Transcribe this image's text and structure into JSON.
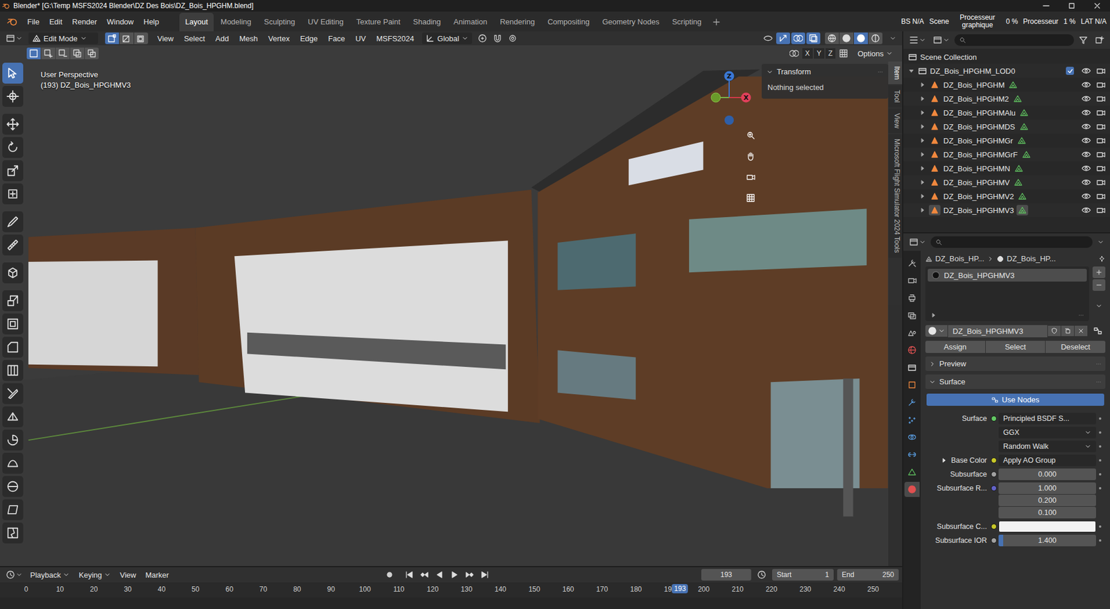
{
  "window": {
    "title": "Blender* [G:\\Temp MSFS2024 Blender\\DZ Des Bois\\DZ_Bois_HPGHM.blend]"
  },
  "menu": [
    "File",
    "Edit",
    "Render",
    "Window",
    "Help"
  ],
  "workspaces": [
    {
      "label": "Layout",
      "selected": true
    },
    {
      "label": "Modeling",
      "selected": false
    },
    {
      "label": "Sculpting",
      "selected": false
    },
    {
      "label": "UV Editing",
      "selected": false
    },
    {
      "label": "Texture Paint",
      "selected": false
    },
    {
      "label": "Shading",
      "selected": false
    },
    {
      "label": "Animation",
      "selected": false
    },
    {
      "label": "Rendering",
      "selected": false
    },
    {
      "label": "Compositing",
      "selected": false
    },
    {
      "label": "Geometry Nodes",
      "selected": false
    },
    {
      "label": "Scripting",
      "selected": false
    }
  ],
  "status": [
    "BS N/A",
    "Scene",
    "Processeur graphique",
    "0 %",
    "Processeur",
    "1 %",
    "LAT N/A"
  ],
  "viewport": {
    "mode": "Edit Mode",
    "select_modes": [
      {
        "selected": true
      },
      {
        "selected": false
      },
      {
        "selected": false
      }
    ],
    "menus": [
      "View",
      "Select",
      "Add",
      "Mesh",
      "Vertex",
      "Edge",
      "Face",
      "UV",
      "MSFS2024"
    ],
    "orientation": "Global",
    "view_toggles": [
      {
        "on": false
      },
      {
        "on": true
      },
      {
        "on": true
      },
      {
        "on": true
      }
    ],
    "shading": [
      {
        "selected": false
      },
      {
        "selected": false
      },
      {
        "selected": true
      },
      {
        "selected": false
      }
    ],
    "box_modes": [
      {
        "selected": true
      },
      {
        "selected": false
      },
      {
        "selected": false
      },
      {
        "selected": false
      },
      {
        "selected": false
      }
    ],
    "mirror_axes": [
      {
        "label": "X",
        "on": false
      },
      {
        "label": "Y",
        "on": false
      },
      {
        "label": "Z",
        "on": false
      }
    ],
    "options": "Options",
    "view_name": "User Perspective",
    "object_name": "(193) DZ_Bois_HPGHMV3",
    "tools": [
      {
        "selected": true
      },
      {
        "selected": false
      },
      {
        "selected": false
      },
      {
        "selected": false
      },
      {
        "selected": false
      },
      {
        "selected": false
      },
      {
        "selected": false
      },
      {
        "selected": false
      },
      {
        "selected": false
      },
      {
        "selected": false
      },
      {
        "selected": false
      },
      {
        "selected": false
      },
      {
        "selected": false
      },
      {
        "selected": false
      },
      {
        "selected": false
      },
      {
        "selected": false
      },
      {
        "selected": false
      },
      {
        "selected": false
      },
      {
        "selected": false
      },
      {
        "selected": false
      }
    ],
    "gizmo": {
      "x": "X",
      "z": "Z"
    },
    "sidebar": {
      "title": "Transform",
      "expanded": true,
      "message": "Nothing selected",
      "tabs": [
        {
          "label": "Item",
          "selected": true
        },
        {
          "label": "Tool",
          "selected": false
        },
        {
          "label": "View",
          "selected": false
        },
        {
          "label": "Microsoft Flight Simulator 2024 Tools",
          "selected": false
        }
      ]
    }
  },
  "timeline": {
    "menus": [
      "Playback",
      "Keying",
      "View",
      "Marker"
    ],
    "frame": "193",
    "start_label": "Start",
    "start": "1",
    "end_label": "End",
    "end": "250",
    "ticks": [
      "0",
      "10",
      "20",
      "30",
      "40",
      "50",
      "60",
      "70",
      "80",
      "90",
      "100",
      "110",
      "120",
      "130",
      "140",
      "150",
      "160",
      "170",
      "180",
      "190",
      "200",
      "210",
      "220",
      "230",
      "240",
      "250"
    ],
    "playhead": "193"
  },
  "outliner": {
    "root": "Scene Collection",
    "collection": {
      "name": "DZ_Bois_HPGHM_LOD0",
      "checked": true,
      "expanded": true
    },
    "objects": [
      {
        "name": "DZ_Bois_HPGHM",
        "active": false
      },
      {
        "name": "DZ_Bois_HPGHM2",
        "active": false
      },
      {
        "name": "DZ_Bois_HPGHMAlu",
        "active": false
      },
      {
        "name": "DZ_Bois_HPGHMDS",
        "active": false
      },
      {
        "name": "DZ_Bois_HPGHMGr",
        "active": false
      },
      {
        "name": "DZ_Bois_HPGHMGrF",
        "active": false
      },
      {
        "name": "DZ_Bois_HPGHMN",
        "active": false
      },
      {
        "name": "DZ_Bois_HPGHMV",
        "active": false
      },
      {
        "name": "DZ_Bois_HPGHMV2",
        "active": false
      },
      {
        "name": "DZ_Bois_HPGHMV3",
        "active": true
      }
    ]
  },
  "properties": {
    "tabs": [
      {
        "selected": false,
        "color": "#bdbdbd"
      },
      {
        "selected": false,
        "color": "#bdbdbd"
      },
      {
        "selected": false,
        "color": "#bdbdbd"
      },
      {
        "selected": false,
        "color": "#bdbdbd"
      },
      {
        "selected": false,
        "color": "#bdbdbd"
      },
      {
        "selected": false,
        "color": "#d95050"
      },
      {
        "selected": false,
        "color": "#e0e0e0"
      },
      {
        "selected": false,
        "color": "#f0883e"
      },
      {
        "selected": false,
        "color": "#5a9de0"
      },
      {
        "selected": false,
        "color": "#5a9de0"
      },
      {
        "selected": false,
        "color": "#5a9de0"
      },
      {
        "selected": false,
        "color": "#5a9de0"
      },
      {
        "selected": false,
        "color": "#5fbf5f"
      },
      {
        "selected": true,
        "color": "#e05050"
      }
    ],
    "breadcrumb": [
      "DZ_Bois_HP...",
      "DZ_Bois_HP..."
    ],
    "slots": [
      {
        "name": "DZ_Bois_HPGHMV3",
        "selected": true
      }
    ],
    "material": "DZ_Bois_HPGHMV3",
    "actions": [
      "Assign",
      "Select",
      "Deselect"
    ],
    "panels": [
      {
        "label": "Preview",
        "expanded": false
      },
      {
        "label": "Surface",
        "expanded": true
      }
    ],
    "use_nodes": {
      "label": "Use Nodes",
      "on": true
    },
    "fields": [
      {
        "kind": "link",
        "label": "Surface",
        "value": "Principled BSDF S...",
        "color": "#63c763"
      },
      {
        "kind": "dropdown",
        "value": "GGX"
      },
      {
        "kind": "dropdown",
        "value": "Random Walk"
      },
      {
        "kind": "link",
        "label": "Base Color",
        "value": "Apply AO Group",
        "color": "#c7c729",
        "expandable": true
      },
      {
        "kind": "number",
        "label": "Subsurface",
        "value": "0.000",
        "color": "#a1a1a1"
      },
      {
        "kind": "vector",
        "label": "Subsurface R...",
        "values": [
          "1.000",
          "0.200",
          "0.100"
        ],
        "color": "#6363c7"
      },
      {
        "kind": "color",
        "label": "Subsurface C...",
        "swatch": "#f2f2f2",
        "color": "#c7c729"
      },
      {
        "kind": "number",
        "label": "Subsurface IOR",
        "value": "1.400",
        "color": "#a1a1a1",
        "level": 0.05
      }
    ]
  }
}
